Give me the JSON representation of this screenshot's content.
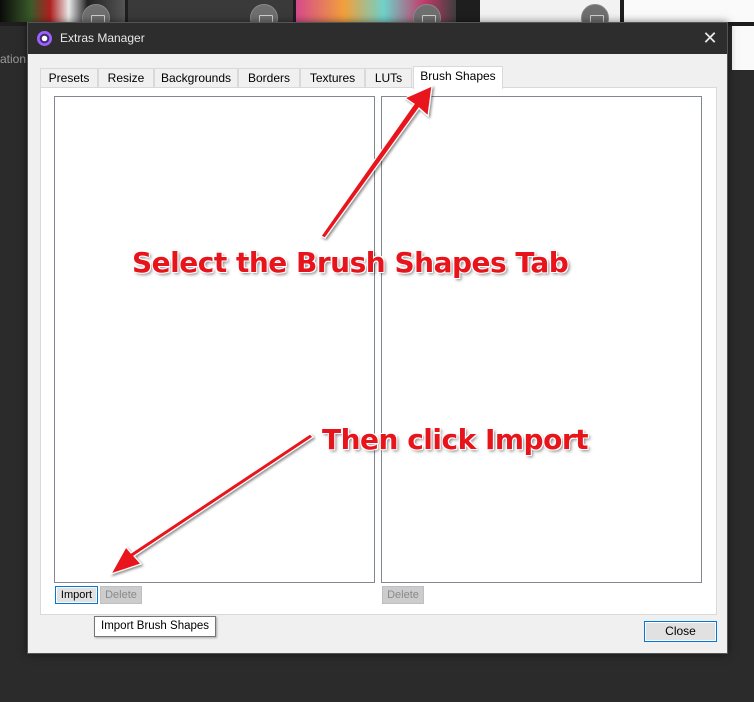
{
  "background": {
    "side_label": "ation"
  },
  "dialog": {
    "title": "Extras Manager",
    "close_glyph": "✕",
    "tabs": [
      {
        "label": "Presets",
        "active": false
      },
      {
        "label": "Resize",
        "active": false
      },
      {
        "label": "Backgrounds",
        "active": false
      },
      {
        "label": "Borders",
        "active": false
      },
      {
        "label": "Textures",
        "active": false
      },
      {
        "label": "LUTs",
        "active": false
      },
      {
        "label": "Brush Shapes",
        "active": true
      }
    ],
    "left_panel": {
      "import_label": "Import",
      "delete_label": "Delete"
    },
    "right_panel": {
      "delete_label": "Delete"
    },
    "tooltip": "Import Brush Shapes",
    "close_button": "Close"
  },
  "annotations": {
    "step1": "Select the Brush Shapes Tab",
    "step2": "Then click Import",
    "color": "#e8141b"
  }
}
